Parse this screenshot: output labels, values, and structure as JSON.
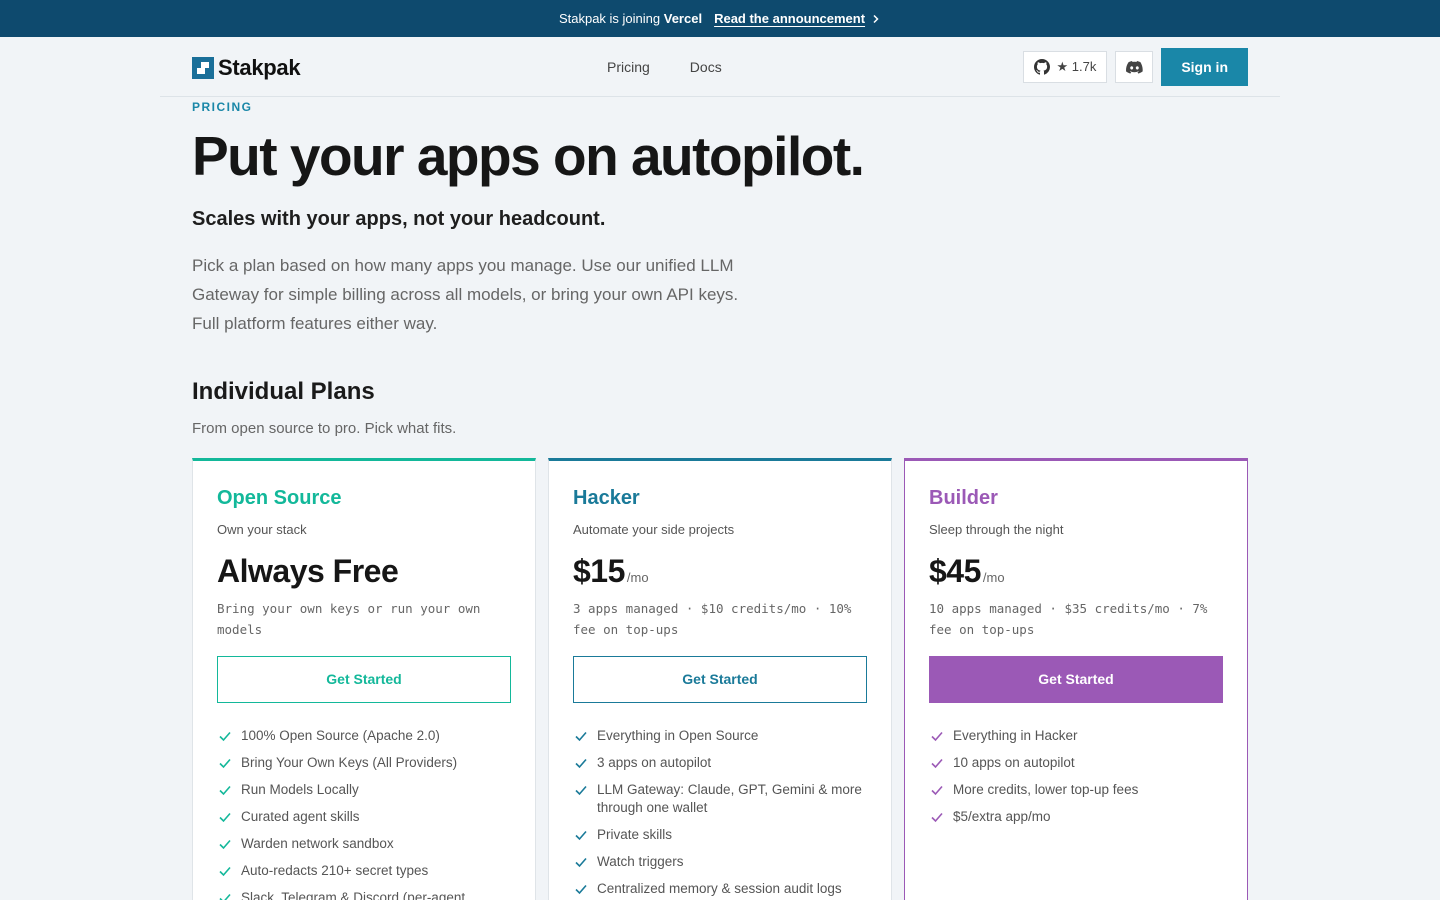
{
  "banner": {
    "text": "Stakpak is joining",
    "brand": "Vercel",
    "link": "Read the announcement"
  },
  "nav": {
    "logo": "Stakpak",
    "links": [
      "Pricing",
      "Docs"
    ],
    "github_stars": "★ 1.7k",
    "signin": "Sign in"
  },
  "hero": {
    "eyebrow": "PRICING",
    "title": "Put your apps on autopilot.",
    "subtitle": "Scales with your apps, not your headcount.",
    "lead": "Pick a plan based on how many apps you manage. Use our unified LLM Gateway for simple billing across all models, or bring your own API keys. Full platform features either way."
  },
  "section": {
    "title": "Individual Plans",
    "subtitle": "From open source to pro. Pick what fits."
  },
  "plans": [
    {
      "name": "Open Source",
      "tagline": "Own your stack",
      "price": "Always Free",
      "per": "",
      "details": "Bring your own keys or run your own models",
      "cta": "Get Started",
      "features": [
        "100% Open Source (Apache 2.0)",
        "Bring Your Own Keys (All Providers)",
        "Run Models Locally",
        "Curated agent skills",
        "Warden network sandbox",
        "Auto-redacts 210+ secret types",
        "Slack, Telegram & Discord (per-agent"
      ]
    },
    {
      "name": "Hacker",
      "tagline": "Automate your side projects",
      "price": "$15",
      "per": "/mo",
      "details": "3 apps managed · $10 credits/mo · 10% fee on top-ups",
      "cta": "Get Started",
      "features": [
        "Everything in Open Source",
        "3 apps on autopilot",
        "LLM Gateway: Claude, GPT, Gemini & more through one wallet",
        "Private skills",
        "Watch triggers",
        "Centralized memory & session audit logs"
      ]
    },
    {
      "name": "Builder",
      "tagline": "Sleep through the night",
      "price": "$45",
      "per": "/mo",
      "details": "10 apps managed · $35 credits/mo · 7% fee on top-ups",
      "cta": "Get Started",
      "features": [
        "Everything in Hacker",
        "10 apps on autopilot",
        "More credits, lower top-up fees",
        "$5/extra app/mo"
      ]
    }
  ],
  "colors": {
    "banner_bg": "#0e4a6e",
    "accent": "#1a87a8",
    "open_source": "#13b89a",
    "hacker": "#1a7a99",
    "builder": "#9b59b6"
  }
}
